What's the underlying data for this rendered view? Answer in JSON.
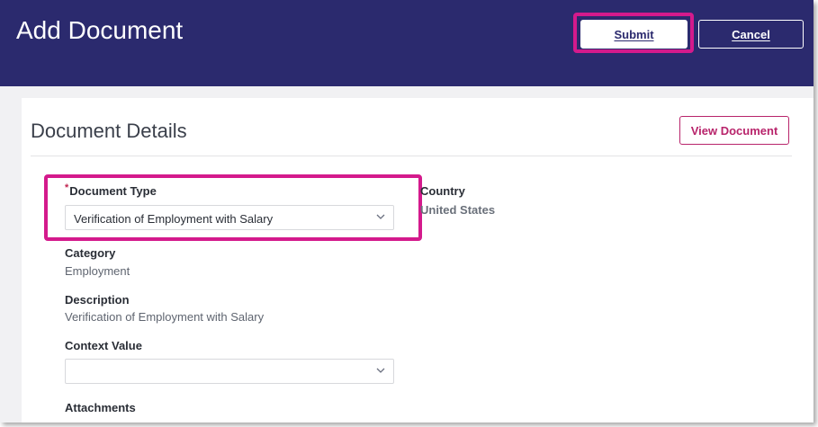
{
  "header": {
    "title": "Add Document",
    "submit_label": "Submit",
    "cancel_label": "Cancel"
  },
  "details": {
    "section_title": "Document Details",
    "view_document_label": "View Document",
    "document_type": {
      "label": "Document Type",
      "required_mark": "*",
      "value": "Verification of Employment with Salary"
    },
    "country": {
      "label": "Country",
      "value": "United States"
    },
    "category": {
      "label": "Category",
      "value": "Employment"
    },
    "description": {
      "label": "Description",
      "value": "Verification of Employment with Salary"
    },
    "context_value": {
      "label": "Context Value",
      "value": ""
    },
    "attachments": {
      "label": "Attachments"
    }
  },
  "colors": {
    "header_bg": "#2b2a6e",
    "highlight": "#d41a8c",
    "accent": "#b8246b"
  },
  "icons": [
    "chevron-down-icon"
  ]
}
